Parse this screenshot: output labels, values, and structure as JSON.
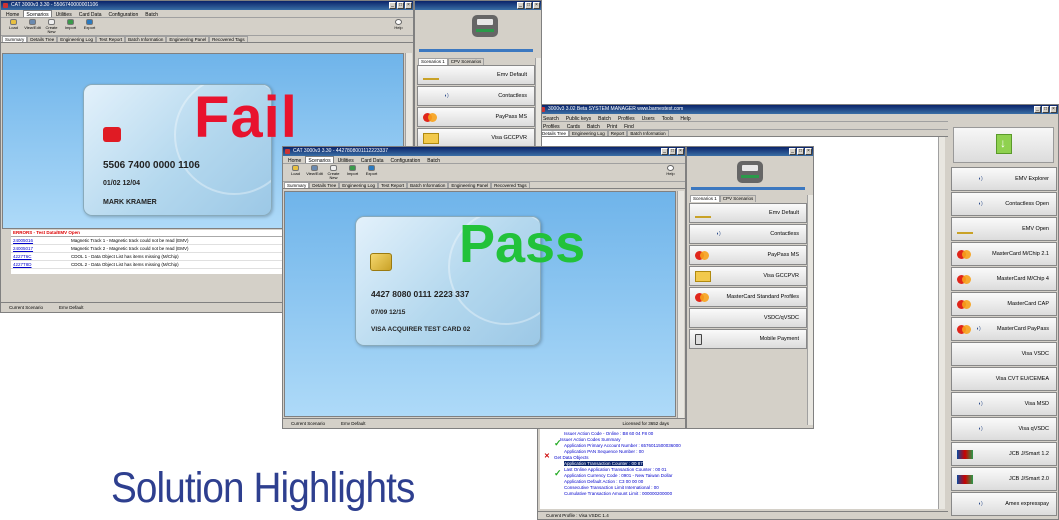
{
  "headline": "Solution Highlights",
  "win1": {
    "title": "CAT 3000v3  3.30 - 5506740000001106",
    "menu": [
      "Home",
      "Scenarios",
      "Utilities",
      "Card Data",
      "Configuration",
      "Batch"
    ],
    "tools": [
      "Load",
      "View/Edit",
      "Create New",
      "Import",
      "Export"
    ],
    "help": "Help",
    "tabs": [
      "Summary",
      "Details Tree",
      "Engineering Log",
      "Test Report",
      "Batch Information",
      "Engineering Panel",
      "Recovered Tags"
    ],
    "result": "Fail",
    "card": {
      "number": "5506 7400 0000 1106",
      "date": "01/02 12/04",
      "name": "MARK KRAMER"
    },
    "errors_title": "ERRORS - Test Data/EMV Open",
    "errors": [
      {
        "code": "24005016",
        "text": "Magnetic Track 1 - Magnetic track could not be read (EMV)"
      },
      {
        "code": "24005017",
        "text": "Magnetic Track 2 - Magnetic track could not be read (EMV)"
      },
      {
        "code": "4227T6C",
        "text": "CDOL 1 - Data Object List has items missing (M/Chip)"
      },
      {
        "code": "4227T8D",
        "text": "CDOL 2 - Data Object List has items missing (M/Chip)"
      }
    ],
    "status": [
      "Current Scenario",
      "Emv Default"
    ]
  },
  "side1": {
    "tabs": [
      "Scenarios 1",
      "CPV Scenarios"
    ],
    "rows": [
      {
        "logo": "EMVCo",
        "label": "Emv Default",
        "color": "#8a7a00"
      },
      {
        "logo": "Barnes",
        "label": "Contactless",
        "color": "#1b3c8a"
      },
      {
        "logo": "MC",
        "label": "PayPass MS",
        "color": "#e0261b"
      },
      {
        "logo": "folder",
        "label": "Visa GCCPVR",
        "color": "#e8b830"
      }
    ]
  },
  "win2": {
    "title": "CAT 3000v3  3.30 - 4427808001112223337",
    "menu": [
      "Home",
      "Scenarios",
      "Utilities",
      "Card Data",
      "Configuration",
      "Batch"
    ],
    "tools": [
      "Load",
      "View/Edit",
      "Create New",
      "Import",
      "Export"
    ],
    "help": "Help",
    "tabs": [
      "Summary",
      "Details Tree",
      "Engineering Log",
      "Test Report",
      "Batch Information",
      "Engineering Panel",
      "Recovered Tags"
    ],
    "result": "Pass",
    "card": {
      "number": "4427 8080 0111 2223 337",
      "date": "07/09 12/15",
      "name": "VISA ACQUIRER TEST CARD 02"
    },
    "status": [
      "Current Scenario",
      "Emv Default"
    ],
    "licensed": "Licensed for 3652 days"
  },
  "side2": {
    "tabs": [
      "Scenarios 1",
      "CPV Scenarios"
    ],
    "rows": [
      {
        "logo": "EMVCo",
        "label": "Emv Default",
        "color": "#8a7a00"
      },
      {
        "logo": "Barnes",
        "label": "Contactless",
        "color": "#1b3c8a"
      },
      {
        "logo": "MC",
        "label": "PayPass MS",
        "color": "#e0261b"
      },
      {
        "logo": "folder",
        "label": "Visa GCCPVR",
        "color": "#e8b830"
      },
      {
        "logo": "MC",
        "label": "MasterCard Standard Profiles",
        "color": "#e0261b"
      },
      {
        "logo": "Visa",
        "label": "VSDC/qVSDC",
        "color": "#1a1f71"
      },
      {
        "logo": "phone",
        "label": "Mobile Payment",
        "color": "#555"
      }
    ]
  },
  "win3": {
    "title": "3000v3  3.02 Beta  SYSTEM MANAGER   www.barnestest.com",
    "menu": [
      "Search",
      "Public keys",
      "Batch",
      "Profiles",
      "Users",
      "Tools",
      "Help"
    ],
    "toolbar": [
      "Profiles",
      "Cards",
      "Batch",
      "Print",
      "Find"
    ],
    "tabs": [
      "Details Tree",
      "Engineering Log",
      "Report",
      "Batch Information"
    ],
    "tree": [
      {
        "t": "Issuer Action Code - Denial : 00 10 00 00 00",
        "ind": 18,
        "mark": "check"
      },
      {
        "t": "Issuer Action Code - Online : B8 60 04 F8 00",
        "ind": 18,
        "mark": ""
      },
      {
        "t": "Issuer Action Codes Summary",
        "ind": 14,
        "mark": ""
      },
      {
        "t": "Application Primary Account Number : 6576011500036000",
        "ind": 18,
        "mark": "check"
      },
      {
        "t": "Application PAN Sequence Number : 00",
        "ind": 18,
        "mark": ""
      },
      {
        "t": "Get Data Objects",
        "ind": 8,
        "mark": "x"
      },
      {
        "t": "Application Transaction Counter : 00 87",
        "ind": 18,
        "mark": "sel"
      },
      {
        "t": "Last Online Application Transaction Counter : 00 01",
        "ind": 18,
        "mark": ""
      },
      {
        "t": "Application Currency Code : 0901 - New Taiwan Dollar",
        "ind": 18,
        "mark": "check"
      },
      {
        "t": "Application Default Action : C3 00 00 00",
        "ind": 18,
        "mark": ""
      },
      {
        "t": "Consecutive Transaction Limit International : 00",
        "ind": 18,
        "mark": ""
      },
      {
        "t": "Cumulative Transaction Amount Limit : 000000200000",
        "ind": 18,
        "mark": ""
      }
    ],
    "status": "Current Profile : Visa VSDC 1.4",
    "rows": [
      {
        "logo": "Barnes",
        "label": "EMV Explorer",
        "color": "#1b3c8a",
        "wave": false
      },
      {
        "logo": "Barnes",
        "label": "Contactless Open",
        "color": "#1b3c8a",
        "wave": true
      },
      {
        "logo": "EMVCo",
        "label": "EMV Open",
        "color": "#8a7a00",
        "wave": false
      },
      {
        "logo": "MC",
        "label": "MasterCard M/Chip 2.1",
        "color": "#e0261b",
        "wave": false
      },
      {
        "logo": "MC",
        "label": "MasterCard M/Chip 4",
        "color": "#e0261b",
        "wave": false
      },
      {
        "logo": "MC",
        "label": "MasterCard CAP",
        "color": "#e0261b",
        "wave": false
      },
      {
        "logo": "MC",
        "label": "MasterCard PayPass",
        "color": "#e0261b",
        "wave": true
      },
      {
        "logo": "VISA",
        "label": "Visa VSDC",
        "color": "#1a1f71",
        "wave": false
      },
      {
        "logo": "VISA",
        "label": "Visa CVT EU/CEMEA",
        "color": "#1a1f71",
        "wave": false
      },
      {
        "logo": "VISA",
        "label": "Visa MSD",
        "color": "#1a1f71",
        "wave": true
      },
      {
        "logo": "VISA",
        "label": "Visa qVSDC",
        "color": "#1a1f71",
        "wave": true
      },
      {
        "logo": "JCB",
        "label": "JCB J/Smart 1.2",
        "color": "#0a4aa0",
        "wave": false
      },
      {
        "logo": "JCB",
        "label": "JCB J/Smart 2.0",
        "color": "#0a4aa0",
        "wave": false
      },
      {
        "logo": "Amex",
        "label": "Amex expresspay",
        "color": "#2a6ad0",
        "wave": true
      }
    ]
  },
  "colors": {
    "fail": "#e8132e",
    "pass": "#22c23a",
    "headline": "#2e3f8f"
  }
}
